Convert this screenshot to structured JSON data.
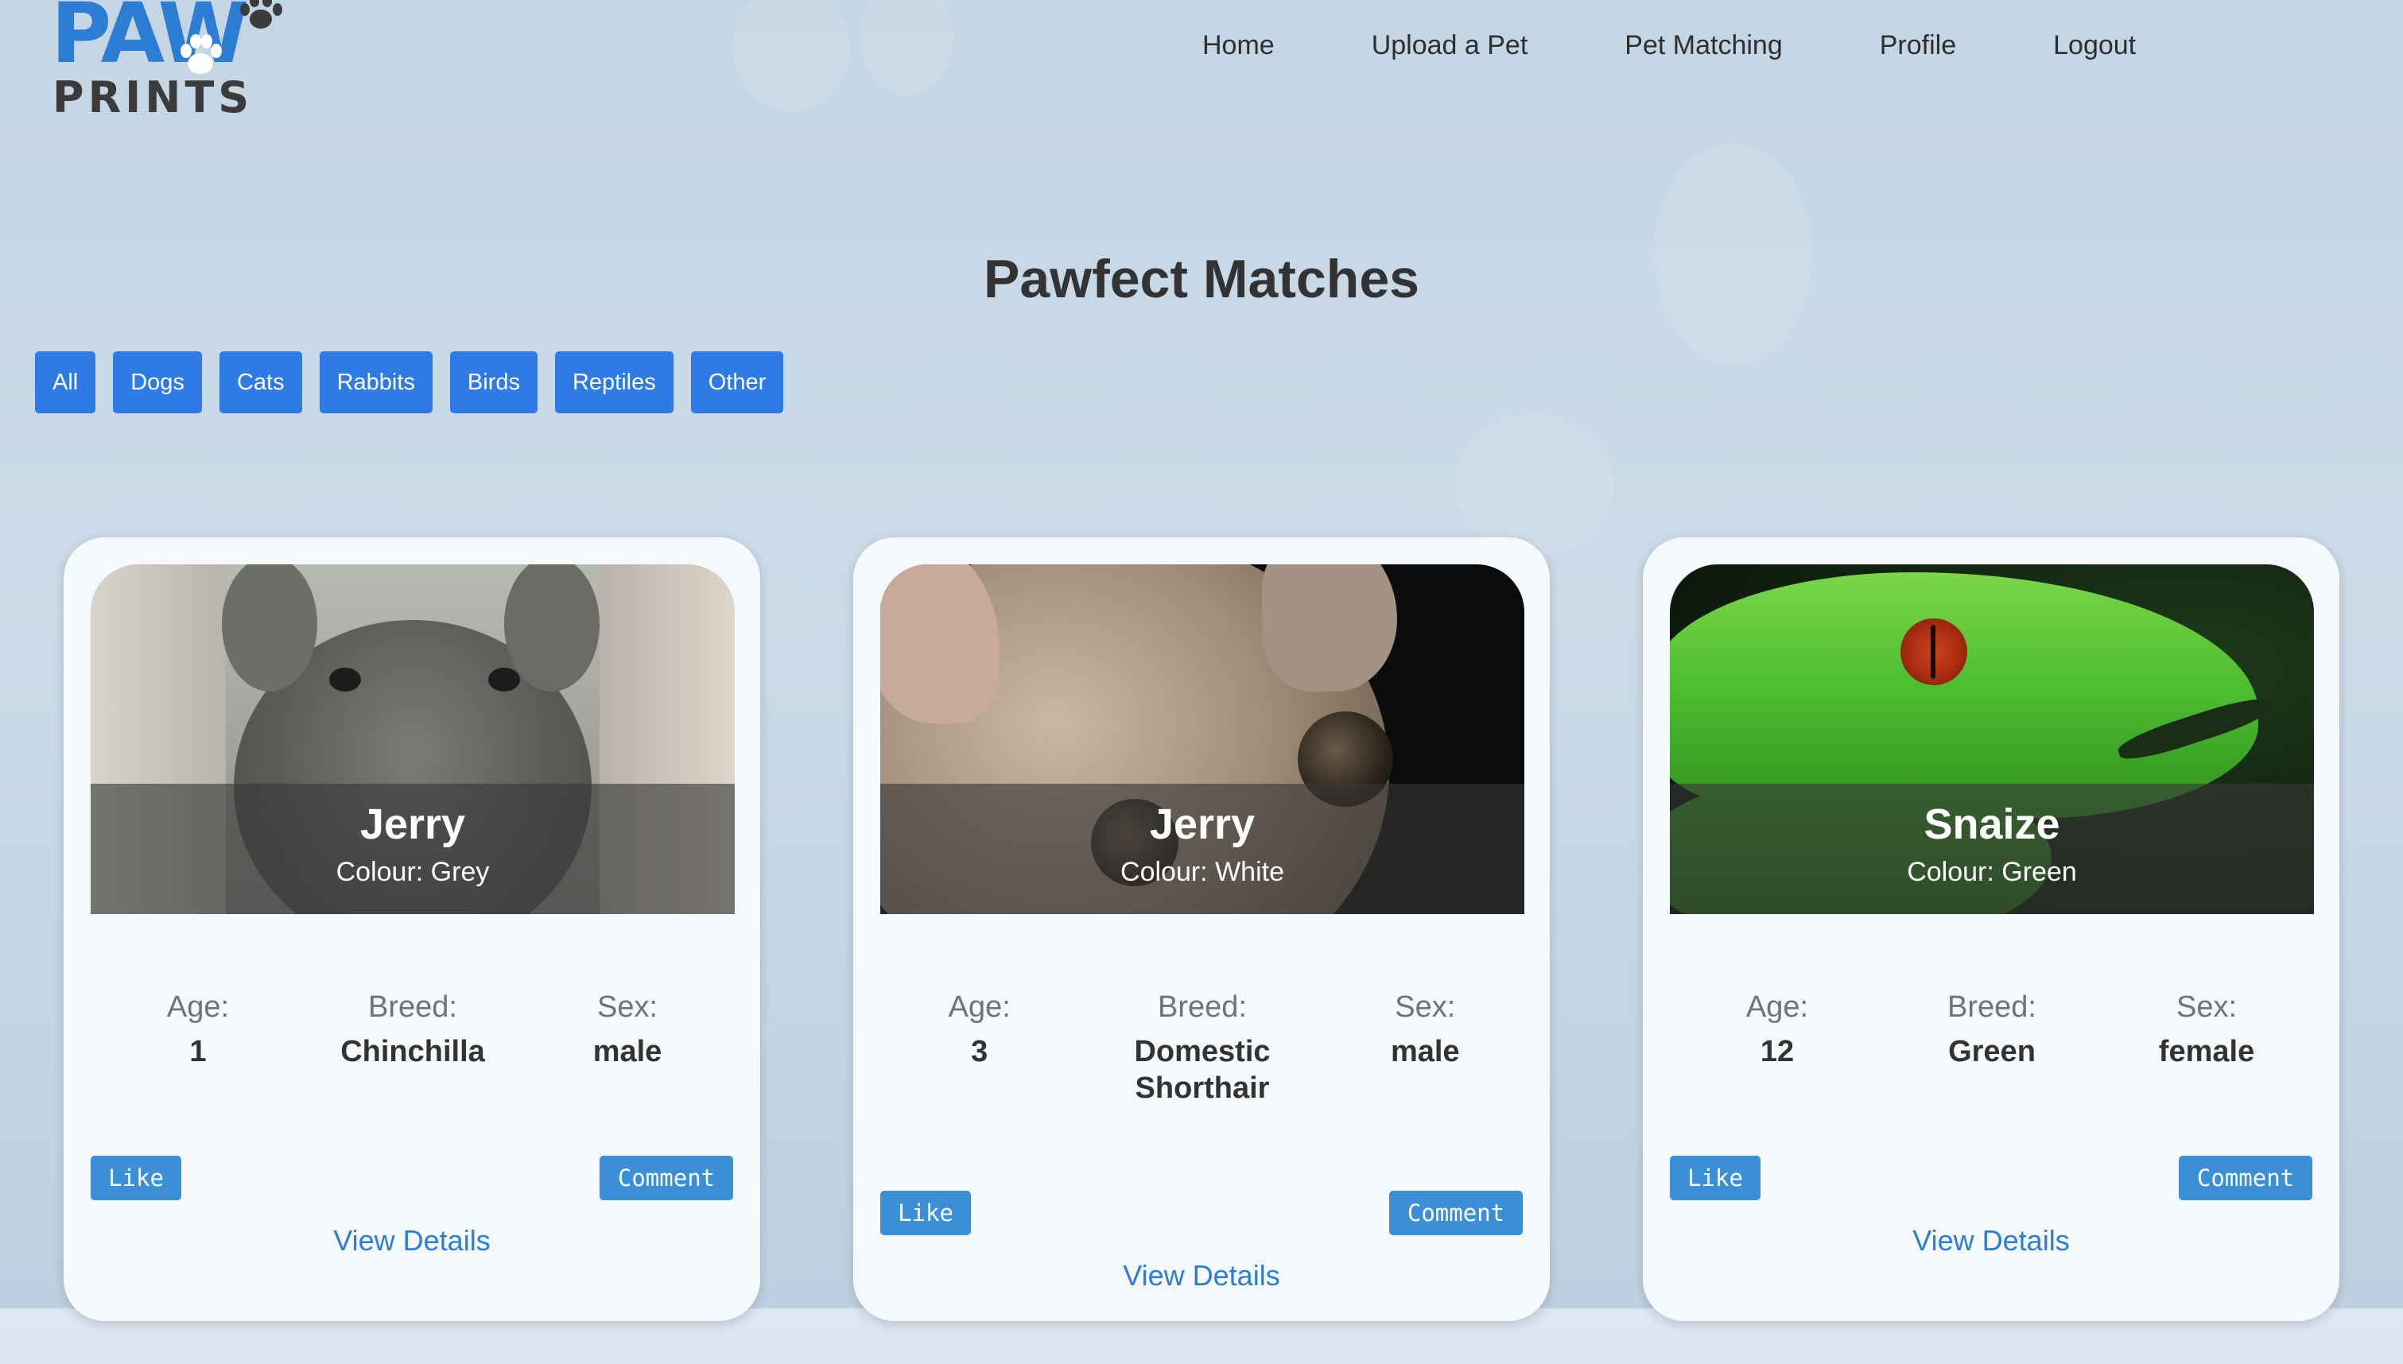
{
  "logo": {
    "top_text": "PAW",
    "bottom_text": "PRINTS"
  },
  "nav": {
    "items": [
      "Home",
      "Upload a Pet",
      "Pet Matching",
      "Profile",
      "Logout"
    ]
  },
  "page_title": "Pawfect Matches",
  "filters": [
    "All",
    "Dogs",
    "Cats",
    "Rabbits",
    "Birds",
    "Reptiles",
    "Other"
  ],
  "cards": [
    {
      "name": "Jerry",
      "colour": "Colour: Grey",
      "age_label": "Age:",
      "age": "1",
      "breed_label": "Breed:",
      "breed": "Chinchilla",
      "sex_label": "Sex:",
      "sex": "male",
      "like": "Like",
      "comment": "Comment",
      "view_details": "View Details"
    },
    {
      "name": "Jerry",
      "colour": "Colour: White",
      "age_label": "Age:",
      "age": "3",
      "breed_label": "Breed:",
      "breed": "Domestic Shorthair",
      "sex_label": "Sex:",
      "sex": "male",
      "like": "Like",
      "comment": "Comment",
      "view_details": "View Details"
    },
    {
      "name": "Snaize",
      "colour": "Colour: Green",
      "age_label": "Age:",
      "age": "12",
      "breed_label": "Breed:",
      "breed": "Green",
      "sex_label": "Sex:",
      "sex": "female",
      "like": "Like",
      "comment": "Comment",
      "view_details": "View Details"
    }
  ],
  "colors": {
    "primary_button": "#2f7be6",
    "card_button": "#3a8fd6",
    "link": "#2b7ed3",
    "logo_blue": "#2b7ed3",
    "logo_dark": "#3b3b3b"
  }
}
